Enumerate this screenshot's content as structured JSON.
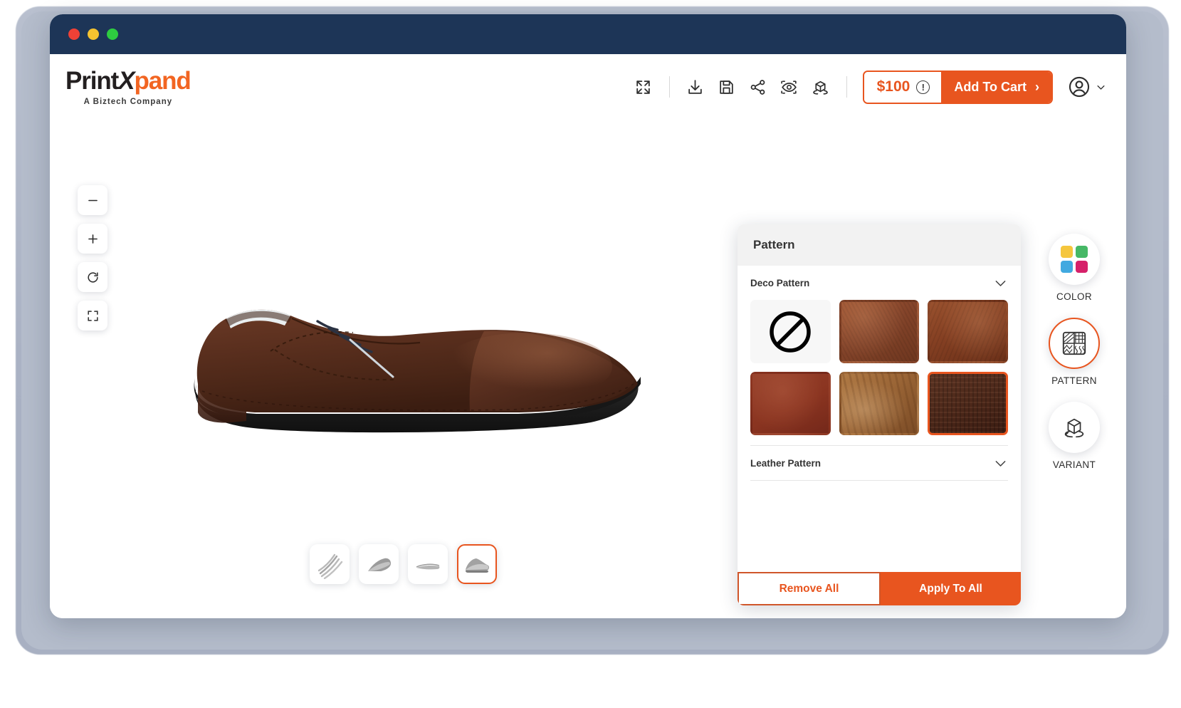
{
  "window": {
    "traffic_lights": [
      "close",
      "minimize",
      "maximize"
    ]
  },
  "brand": {
    "name_part1": "Print",
    "name_x": "X",
    "name_part2": "pand",
    "tagline": "A Biztech Company"
  },
  "toolbar": {
    "icons": [
      {
        "name": "fullscreen-icon",
        "label": "Fullscreen"
      },
      {
        "name": "download-icon",
        "label": "Download"
      },
      {
        "name": "save-icon",
        "label": "Save"
      },
      {
        "name": "share-icon",
        "label": "Share"
      },
      {
        "name": "ar-preview-icon",
        "label": "AR Preview"
      },
      {
        "name": "3d-view-icon",
        "label": "3D View"
      }
    ],
    "price": "$100",
    "info_symbol": "!",
    "add_to_cart": "Add To Cart",
    "cart_chevron": "›",
    "accent_color": "#e8551f"
  },
  "viewport": {
    "zoom_controls": [
      {
        "name": "zoom-out-button",
        "glyph": "minus"
      },
      {
        "name": "zoom-in-button",
        "glyph": "plus"
      },
      {
        "name": "reset-view-button",
        "glyph": "refresh"
      },
      {
        "name": "fit-to-screen-button",
        "glyph": "frame"
      }
    ],
    "product": "brown leather derby dress shoe"
  },
  "part_thumbnails": [
    {
      "name": "part-thumb-laces",
      "label": "Laces",
      "selected": false
    },
    {
      "name": "part-thumb-upper",
      "label": "Upper",
      "selected": false
    },
    {
      "name": "part-thumb-sole",
      "label": "Sole",
      "selected": false
    },
    {
      "name": "part-thumb-full-shoe",
      "label": "Full Shoe",
      "selected": true
    }
  ],
  "panel": {
    "title": "Pattern",
    "sections": [
      {
        "name": "deco-pattern",
        "label": "Deco Pattern",
        "expanded": true,
        "swatches": [
          {
            "name": "swatch-none",
            "label": "None",
            "color": "#f7f7f7",
            "selected": false
          },
          {
            "name": "swatch-pattern-2",
            "label": "Rust Leather",
            "color": "#8f4a2e",
            "selected": false
          },
          {
            "name": "swatch-pattern-3",
            "label": "Cognac Leather",
            "color": "#8d4526",
            "selected": false
          },
          {
            "name": "swatch-pattern-4",
            "label": "Red Brown",
            "color": "#8e3420",
            "selected": false
          },
          {
            "name": "swatch-pattern-5",
            "label": "Tan Distressed",
            "color": "#9c6a3c",
            "selected": false
          },
          {
            "name": "swatch-pattern-6",
            "label": "Dark Chocolate",
            "color": "#4a2a1c",
            "selected": true
          }
        ]
      },
      {
        "name": "leather-pattern",
        "label": "Leather Pattern",
        "expanded": false,
        "swatches": []
      }
    ],
    "footer": {
      "remove_all": "Remove All",
      "apply_to_all": "Apply To All"
    }
  },
  "rail": {
    "tools": [
      {
        "name": "tool-color",
        "label": "COLOR",
        "icon": "color-squares-icon",
        "active": false,
        "swatch_colors": [
          "#f5c63d",
          "#46b866",
          "#41a9e0",
          "#d6216a"
        ]
      },
      {
        "name": "tool-pattern",
        "label": "PATTERN",
        "icon": "pattern-grid-icon",
        "active": true
      },
      {
        "name": "tool-variant",
        "label": "VARIANT",
        "icon": "cube-rotate-icon",
        "active": false
      }
    ]
  }
}
